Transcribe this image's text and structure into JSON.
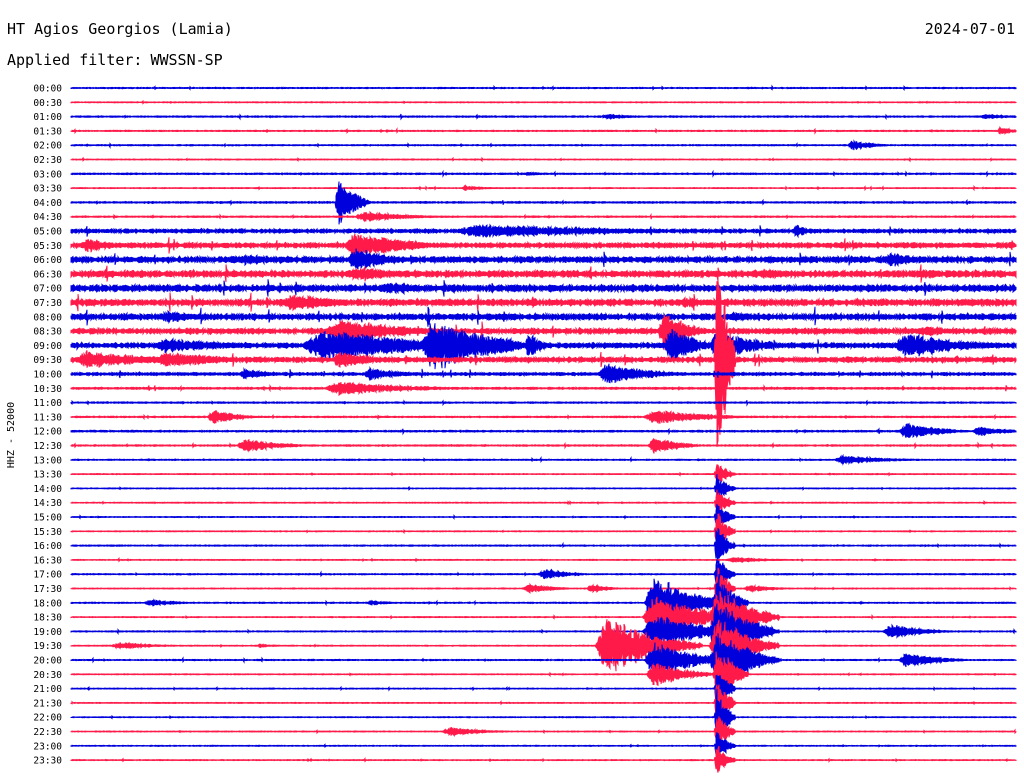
{
  "header": {
    "station": "HT Agios Georgios (Lamia)",
    "date": "2024-07-01",
    "filter_label": "Applied filter:",
    "filter_name": "WWSSN-SP"
  },
  "channel_label": "HHZ - 52000",
  "chart_data": {
    "type": "helicorder",
    "title": "HT Agios Georgios (Lamia)",
    "date": "2024-07-01",
    "filter": "WWSSN-SP",
    "channel": "HHZ - 52000",
    "trace_colors": [
      "#0000dd",
      "#ff1a4a"
    ],
    "tick_labels": [
      "00:00",
      "00:30",
      "01:00",
      "01:30",
      "02:00",
      "02:30",
      "03:00",
      "03:30",
      "04:00",
      "04:30",
      "05:00",
      "05:30",
      "06:00",
      "06:30",
      "07:00",
      "07:30",
      "08:00",
      "08:30",
      "09:00",
      "09:30",
      "10:00",
      "10:30",
      "11:00",
      "11:30",
      "12:00",
      "12:30",
      "13:00",
      "13:30",
      "14:00",
      "14:30",
      "15:00",
      "15:30",
      "16:00",
      "16:30",
      "17:00",
      "17:30",
      "18:00",
      "18:30",
      "19:00",
      "19:30",
      "20:00",
      "20:30",
      "21:00",
      "21:30",
      "22:00",
      "22:30",
      "23:00",
      "23:30"
    ],
    "row_duration_minutes": 30,
    "noise_level": [
      0.5,
      0.4,
      0.6,
      0.5,
      0.5,
      0.4,
      0.6,
      0.4,
      0.7,
      0.6,
      1.6,
      2.0,
      2.4,
      2.6,
      2.6,
      2.6,
      2.4,
      2.2,
      2.0,
      2.0,
      1.2,
      0.8,
      0.6,
      0.6,
      0.7,
      0.6,
      0.5,
      0.4,
      0.4,
      0.4,
      0.4,
      0.4,
      0.5,
      0.4,
      0.5,
      0.4,
      0.5,
      0.4,
      0.5,
      0.4,
      0.5,
      0.4,
      0.4,
      0.4,
      0.4,
      0.4,
      0.4,
      0.4
    ],
    "events": [
      {
        "row": 2,
        "minute": 17.0,
        "amplitude": 3,
        "duration_minutes": 1.5
      },
      {
        "row": 2,
        "minute": 29.0,
        "amplitude": 3,
        "duration_minutes": 1.5
      },
      {
        "row": 3,
        "minute": 29.5,
        "amplitude": 5,
        "duration_minutes": 0.8
      },
      {
        "row": 4,
        "minute": 24.8,
        "amplitude": 6,
        "duration_minutes": 1.2
      },
      {
        "row": 6,
        "minute": 14.5,
        "amplitude": 2,
        "duration_minutes": 1.0
      },
      {
        "row": 7,
        "minute": 12.5,
        "amplitude": 3,
        "duration_minutes": 1.0
      },
      {
        "row": 8,
        "minute": 8.5,
        "amplitude": 28,
        "duration_minutes": 1.0
      },
      {
        "row": 9,
        "minute": 9.3,
        "amplitude": 6,
        "duration_minutes": 2.5
      },
      {
        "row": 10,
        "minute": 13.0,
        "amplitude": 8,
        "duration_minutes": 8.0
      },
      {
        "row": 10,
        "minute": 23.0,
        "amplitude": 7,
        "duration_minutes": 1.0
      },
      {
        "row": 11,
        "minute": 0.5,
        "amplitude": 9,
        "duration_minutes": 1.5
      },
      {
        "row": 11,
        "minute": 9.0,
        "amplitude": 14,
        "duration_minutes": 3.0
      },
      {
        "row": 11,
        "minute": 9.8,
        "amplitude": 10,
        "duration_minutes": 2.5
      },
      {
        "row": 12,
        "minute": 5.5,
        "amplitude": 6,
        "duration_minutes": 3.0
      },
      {
        "row": 12,
        "minute": 9.0,
        "amplitude": 14,
        "duration_minutes": 2.0
      },
      {
        "row": 12,
        "minute": 26.0,
        "amplitude": 8,
        "duration_minutes": 2.0
      },
      {
        "row": 13,
        "minute": 9.0,
        "amplitude": 8,
        "duration_minutes": 3.0
      },
      {
        "row": 13,
        "minute": 22.0,
        "amplitude": 6,
        "duration_minutes": 2.0
      },
      {
        "row": 13,
        "minute": 27.0,
        "amplitude": 6,
        "duration_minutes": 1.5
      },
      {
        "row": 14,
        "minute": 10.0,
        "amplitude": 6,
        "duration_minutes": 3.0
      },
      {
        "row": 15,
        "minute": 7.0,
        "amplitude": 10,
        "duration_minutes": 3.0
      },
      {
        "row": 15,
        "minute": 19.5,
        "amplitude": 6,
        "duration_minutes": 2.0
      },
      {
        "row": 16,
        "minute": 3.0,
        "amplitude": 7,
        "duration_minutes": 2.0
      },
      {
        "row": 16,
        "minute": 21.0,
        "amplitude": 5,
        "duration_minutes": 2.0
      },
      {
        "row": 17,
        "minute": 8.5,
        "amplitude": 14,
        "duration_minutes": 4.0
      },
      {
        "row": 17,
        "minute": 18.8,
        "amplitude": 22,
        "duration_minutes": 1.5
      },
      {
        "row": 17,
        "minute": 27.0,
        "amplitude": 6,
        "duration_minutes": 2.0
      },
      {
        "row": 18,
        "minute": 3.0,
        "amplitude": 8,
        "duration_minutes": 4.0
      },
      {
        "row": 18,
        "minute": 8.0,
        "amplitude": 18,
        "duration_minutes": 6.0
      },
      {
        "row": 18,
        "minute": 11.5,
        "amplitude": 30,
        "duration_minutes": 3.5
      },
      {
        "row": 18,
        "minute": 14.5,
        "amplitude": 15,
        "duration_minutes": 0.8
      },
      {
        "row": 18,
        "minute": 19.0,
        "amplitude": 22,
        "duration_minutes": 1.5
      },
      {
        "row": 18,
        "minute": 20.5,
        "amplitude": 16,
        "duration_minutes": 2.5
      },
      {
        "row": 18,
        "minute": 26.5,
        "amplitude": 14,
        "duration_minutes": 3.5
      },
      {
        "row": 19,
        "minute": 0.5,
        "amplitude": 10,
        "duration_minutes": 4.0
      },
      {
        "row": 19,
        "minute": 3.0,
        "amplitude": 9,
        "duration_minutes": 3.5
      },
      {
        "row": 19,
        "minute": 8.5,
        "amplitude": 10,
        "duration_minutes": 2.0
      },
      {
        "row": 19,
        "minute": 20.5,
        "amplitude": 150,
        "duration_minutes": 0.6
      },
      {
        "row": 20,
        "minute": 5.5,
        "amplitude": 6,
        "duration_minutes": 1.5
      },
      {
        "row": 20,
        "minute": 9.5,
        "amplitude": 7,
        "duration_minutes": 2.0
      },
      {
        "row": 20,
        "minute": 17.0,
        "amplitude": 12,
        "duration_minutes": 2.5
      },
      {
        "row": 21,
        "minute": 8.5,
        "amplitude": 8,
        "duration_minutes": 4.0
      },
      {
        "row": 23,
        "minute": 4.5,
        "amplitude": 8,
        "duration_minutes": 1.5
      },
      {
        "row": 23,
        "minute": 18.5,
        "amplitude": 8,
        "duration_minutes": 3.0
      },
      {
        "row": 24,
        "minute": 26.5,
        "amplitude": 9,
        "duration_minutes": 2.0
      },
      {
        "row": 24,
        "minute": 28.8,
        "amplitude": 6,
        "duration_minutes": 1.5
      },
      {
        "row": 25,
        "minute": 5.5,
        "amplitude": 8,
        "duration_minutes": 2.0
      },
      {
        "row": 25,
        "minute": 18.5,
        "amplitude": 10,
        "duration_minutes": 1.5
      },
      {
        "row": 26,
        "minute": 24.5,
        "amplitude": 5,
        "duration_minutes": 2.5
      },
      {
        "row": 27,
        "minute": 20.5,
        "amplitude": 14,
        "duration_minutes": 0.6
      },
      {
        "row": 28,
        "minute": 20.5,
        "amplitude": 16,
        "duration_minutes": 0.6
      },
      {
        "row": 29,
        "minute": 20.5,
        "amplitude": 18,
        "duration_minutes": 0.6
      },
      {
        "row": 30,
        "minute": 20.5,
        "amplitude": 20,
        "duration_minutes": 0.6
      },
      {
        "row": 31,
        "minute": 20.5,
        "amplitude": 22,
        "duration_minutes": 0.6
      },
      {
        "row": 32,
        "minute": 20.5,
        "amplitude": 24,
        "duration_minutes": 0.6
      },
      {
        "row": 33,
        "minute": 21.0,
        "amplitude": 3,
        "duration_minutes": 2.0
      },
      {
        "row": 34,
        "minute": 15.0,
        "amplitude": 6,
        "duration_minutes": 1.5
      },
      {
        "row": 34,
        "minute": 20.5,
        "amplitude": 26,
        "duration_minutes": 0.6
      },
      {
        "row": 35,
        "minute": 14.5,
        "amplitude": 5,
        "duration_minutes": 1.5
      },
      {
        "row": 35,
        "minute": 16.5,
        "amplitude": 5,
        "duration_minutes": 1.0
      },
      {
        "row": 35,
        "minute": 20.5,
        "amplitude": 30,
        "duration_minutes": 0.6
      },
      {
        "row": 35,
        "minute": 21.5,
        "amplitude": 4,
        "duration_minutes": 1.5
      },
      {
        "row": 36,
        "minute": 2.5,
        "amplitude": 4,
        "duration_minutes": 1.5
      },
      {
        "row": 36,
        "minute": 9.5,
        "amplitude": 3,
        "duration_minutes": 1.0
      },
      {
        "row": 36,
        "minute": 18.5,
        "amplitude": 30,
        "duration_minutes": 2.5
      },
      {
        "row": 36,
        "minute": 20.5,
        "amplitude": 34,
        "duration_minutes": 1.0
      },
      {
        "row": 37,
        "minute": 18.5,
        "amplitude": 24,
        "duration_minutes": 3.0
      },
      {
        "row": 37,
        "minute": 20.5,
        "amplitude": 35,
        "duration_minutes": 2.0
      },
      {
        "row": 38,
        "minute": 18.5,
        "amplitude": 20,
        "duration_minutes": 3.0
      },
      {
        "row": 38,
        "minute": 20.5,
        "amplitude": 34,
        "duration_minutes": 2.0
      },
      {
        "row": 38,
        "minute": 26.0,
        "amplitude": 8,
        "duration_minutes": 2.0
      },
      {
        "row": 39,
        "minute": 1.5,
        "amplitude": 4,
        "duration_minutes": 2.0
      },
      {
        "row": 39,
        "minute": 6.0,
        "amplitude": 2,
        "duration_minutes": 1.0
      },
      {
        "row": 39,
        "minute": 17.0,
        "amplitude": 34,
        "duration_minutes": 3.0
      },
      {
        "row": 39,
        "minute": 20.5,
        "amplitude": 32,
        "duration_minutes": 2.0
      },
      {
        "row": 40,
        "minute": 26.5,
        "amplitude": 8,
        "duration_minutes": 2.0
      },
      {
        "row": 40,
        "minute": 18.5,
        "amplitude": 20,
        "duration_minutes": 2.5
      },
      {
        "row": 40,
        "minute": 20.5,
        "amplitude": 34,
        "duration_minutes": 2.0
      },
      {
        "row": 41,
        "minute": 18.5,
        "amplitude": 14,
        "duration_minutes": 2.0
      },
      {
        "row": 41,
        "minute": 20.5,
        "amplitude": 34,
        "duration_minutes": 1.0
      },
      {
        "row": 42,
        "minute": 20.5,
        "amplitude": 30,
        "duration_minutes": 0.6
      },
      {
        "row": 43,
        "minute": 20.5,
        "amplitude": 30,
        "duration_minutes": 0.6
      },
      {
        "row": 44,
        "minute": 20.5,
        "amplitude": 30,
        "duration_minutes": 0.6
      },
      {
        "row": 45,
        "minute": 12.0,
        "amplitude": 5,
        "duration_minutes": 2.0
      },
      {
        "row": 45,
        "minute": 20.5,
        "amplitude": 24,
        "duration_minutes": 0.6
      },
      {
        "row": 46,
        "minute": 20.5,
        "amplitude": 20,
        "duration_minutes": 0.6
      },
      {
        "row": 47,
        "minute": 20.5,
        "amplitude": 18,
        "duration_minutes": 0.6
      }
    ]
  }
}
